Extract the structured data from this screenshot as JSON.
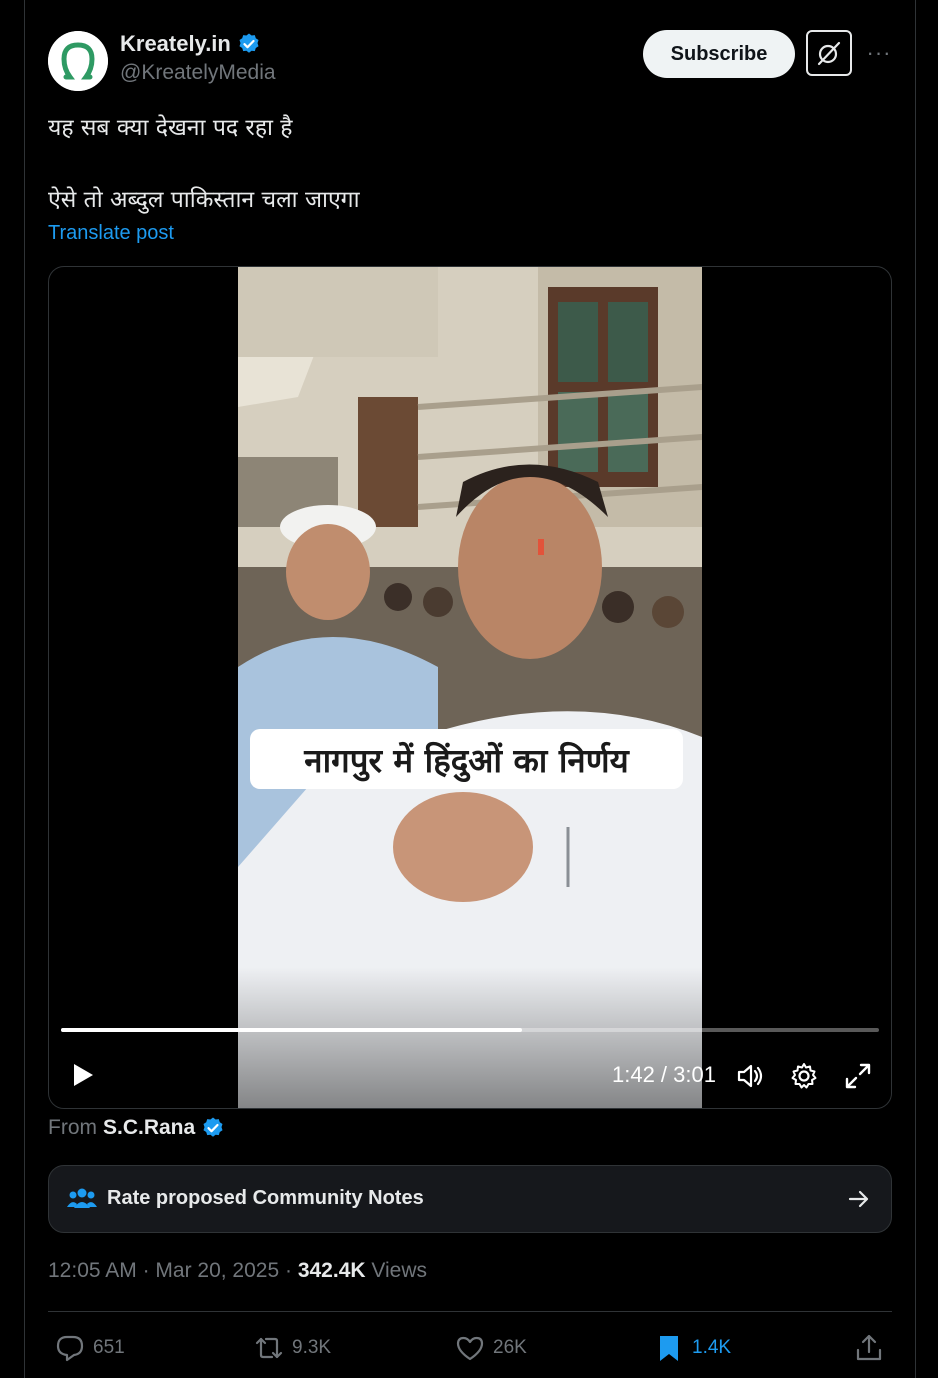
{
  "author": {
    "display_name": "Kreately.in",
    "handle": "@KreatelyMedia"
  },
  "header": {
    "subscribe_label": "Subscribe",
    "more_label": "···"
  },
  "post": {
    "text": "यह सब क्या देखना पद रहा है\n\nऐसे तो अब्दुल पाकिस्तान चला जाएगा",
    "translate_label": "Translate post"
  },
  "video": {
    "caption": "नागपुर में हिंदुओं का निर्णय",
    "time_display": "1:42 / 3:01",
    "progress_fraction": 0.564
  },
  "from": {
    "prefix": "From",
    "name": "S.C.Rana"
  },
  "community_notes": {
    "label": "Rate proposed Community Notes"
  },
  "meta": {
    "time": "12:05 AM",
    "date": "Mar 20, 2025",
    "views_count": "342.4K",
    "views_label": "Views"
  },
  "actions": {
    "replies": "651",
    "reposts": "9.3K",
    "likes": "26K",
    "bookmarks": "1.4K"
  },
  "colors": {
    "accent": "#1d9bf0",
    "background": "#000000",
    "border": "#2f3336",
    "muted": "#71767b"
  }
}
